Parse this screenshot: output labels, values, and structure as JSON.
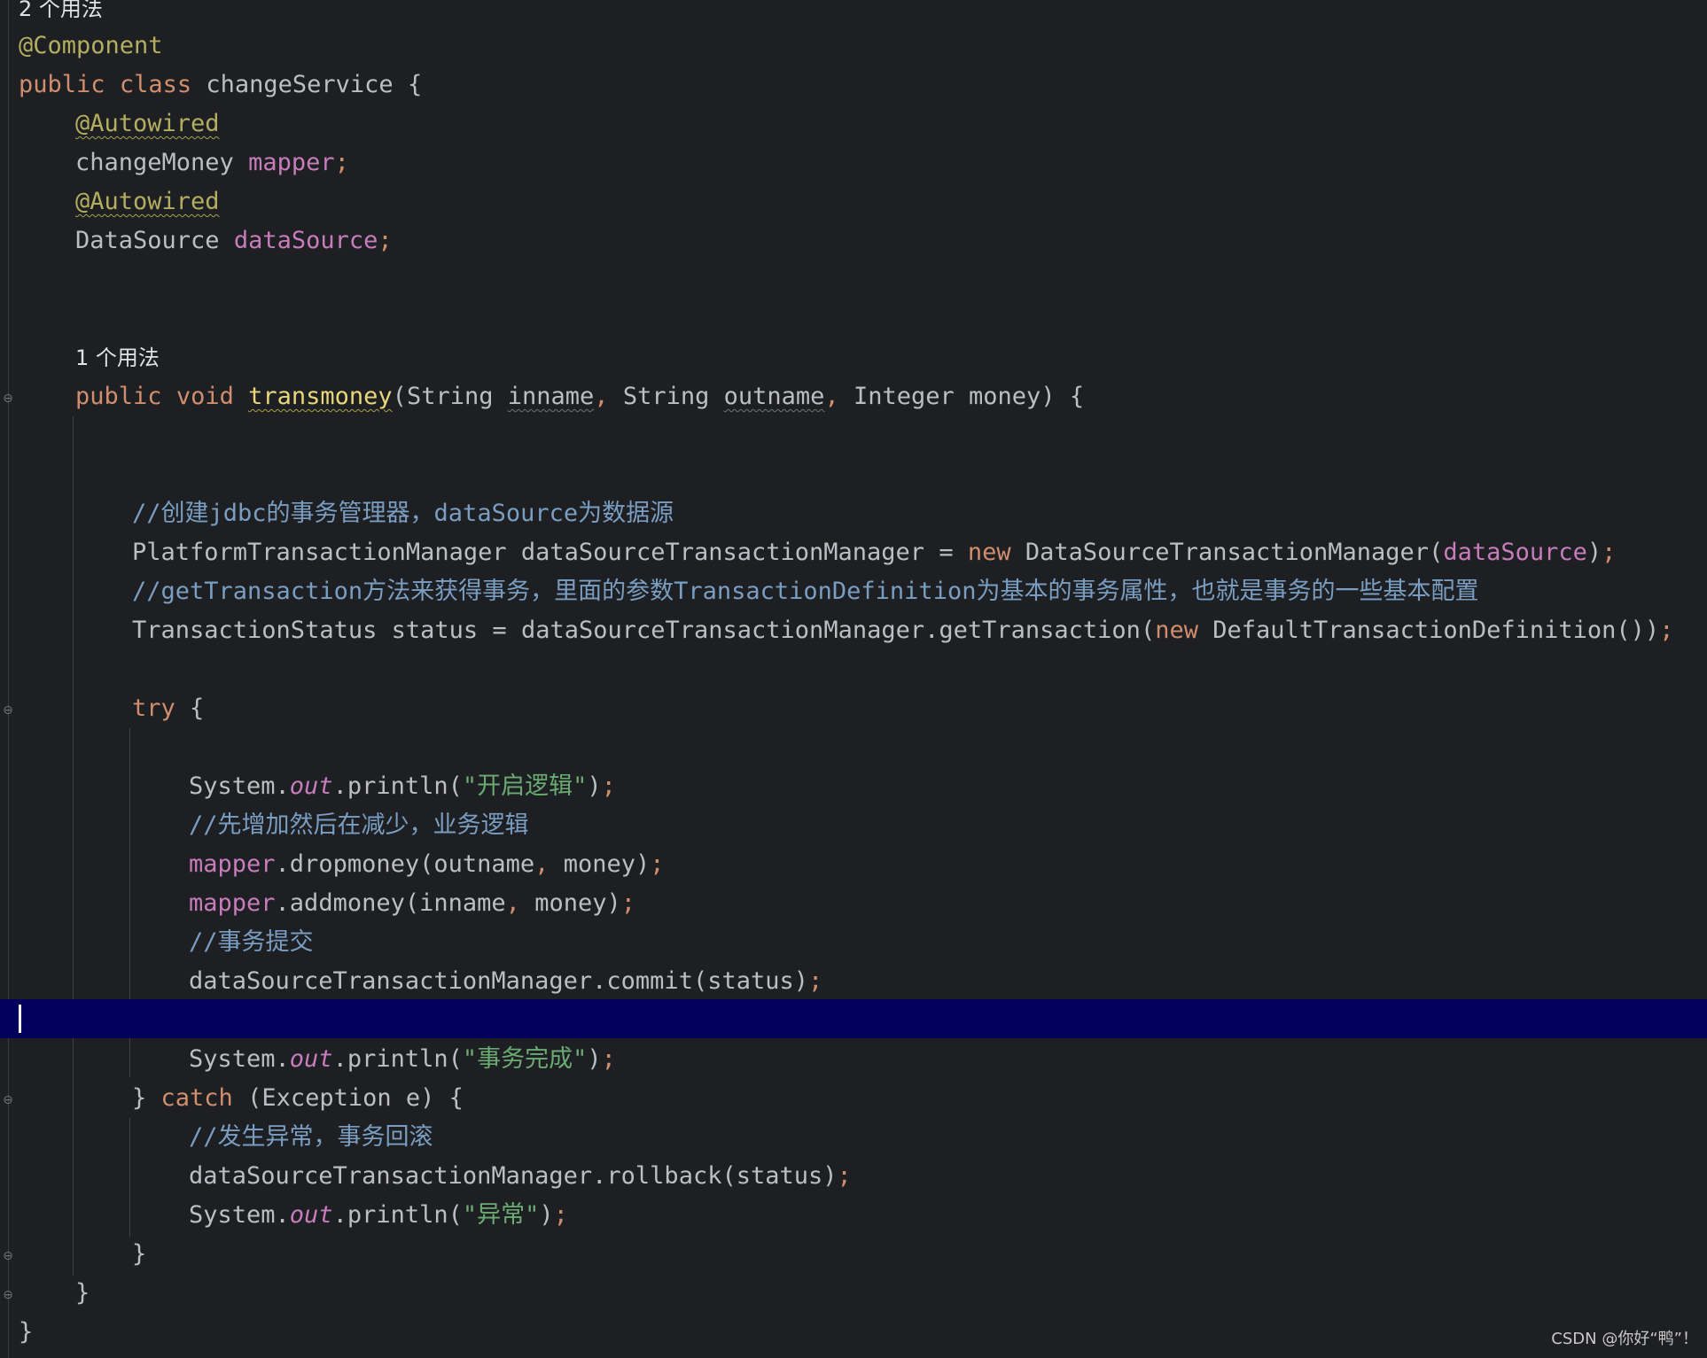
{
  "editor": {
    "usage_hint_class": "2 个用法",
    "usage_hint_method": "1 个用法",
    "annotation_component": "@Component",
    "kw_public": "public",
    "kw_class": "class",
    "class_name": "changeService",
    "open_brace": "{",
    "close_brace": "}",
    "annotation_autowired": "@Autowired",
    "type_changeMoney": "changeMoney",
    "field_mapper": "mapper",
    "type_DataSource": "DataSource",
    "field_dataSource": "dataSource",
    "semicolon": ";",
    "comma": ",",
    "kw_void": "void",
    "method_name": "transmoney",
    "param_type_string": "String",
    "param_inname": "inname",
    "param_outname": "outname",
    "param_type_integer": "Integer",
    "param_money": "money",
    "open_paren": "(",
    "close_paren": ")",
    "comment_create_tm_prefix": "//创建jdbc的事务管理器，",
    "comment_create_tm_ds": "dataSource",
    "comment_create_tm_suffix": "为数据源",
    "type_ptm": "PlatformTransactionManager",
    "var_dstm": "dataSourceTransactionManager",
    "equals": "=",
    "kw_new": "new",
    "type_dstm": "DataSourceTransactionManager",
    "comment_gettx_prefix": "//getTransaction",
    "comment_gettx_mid": "方法来获得事务，里面的参数",
    "comment_gettx_td": "TransactionDefinition",
    "comment_gettx_suffix": "为基本的事务属性，也就是事务的一些基本配置",
    "type_ts": "TransactionStatus",
    "var_status": "status",
    "call_gettx": ".getTransaction(",
    "type_dtd": "DefaultTransactionDefinition",
    "parens_close2": "())",
    "kw_try": "try",
    "sys": "System.",
    "out": "out",
    "println": ".println(",
    "str_start": "\"开启逻辑\"",
    "comment_business": "//先增加然后在减少，业务逻辑",
    "call_drop": ".dropmoney(",
    "call_add": ".addmoney(",
    "comment_commit": "//事务提交",
    "call_commit": ".commit(status)",
    "str_done": "\"事务完成\"",
    "kw_catch": "catch",
    "catch_args": "(Exception e)",
    "comment_rollback": "//发生异常，事务回滚",
    "call_rollback": ".rollback(status)",
    "str_error": "\"异常\""
  },
  "watermark": "CSDN @你好“鸭”！"
}
